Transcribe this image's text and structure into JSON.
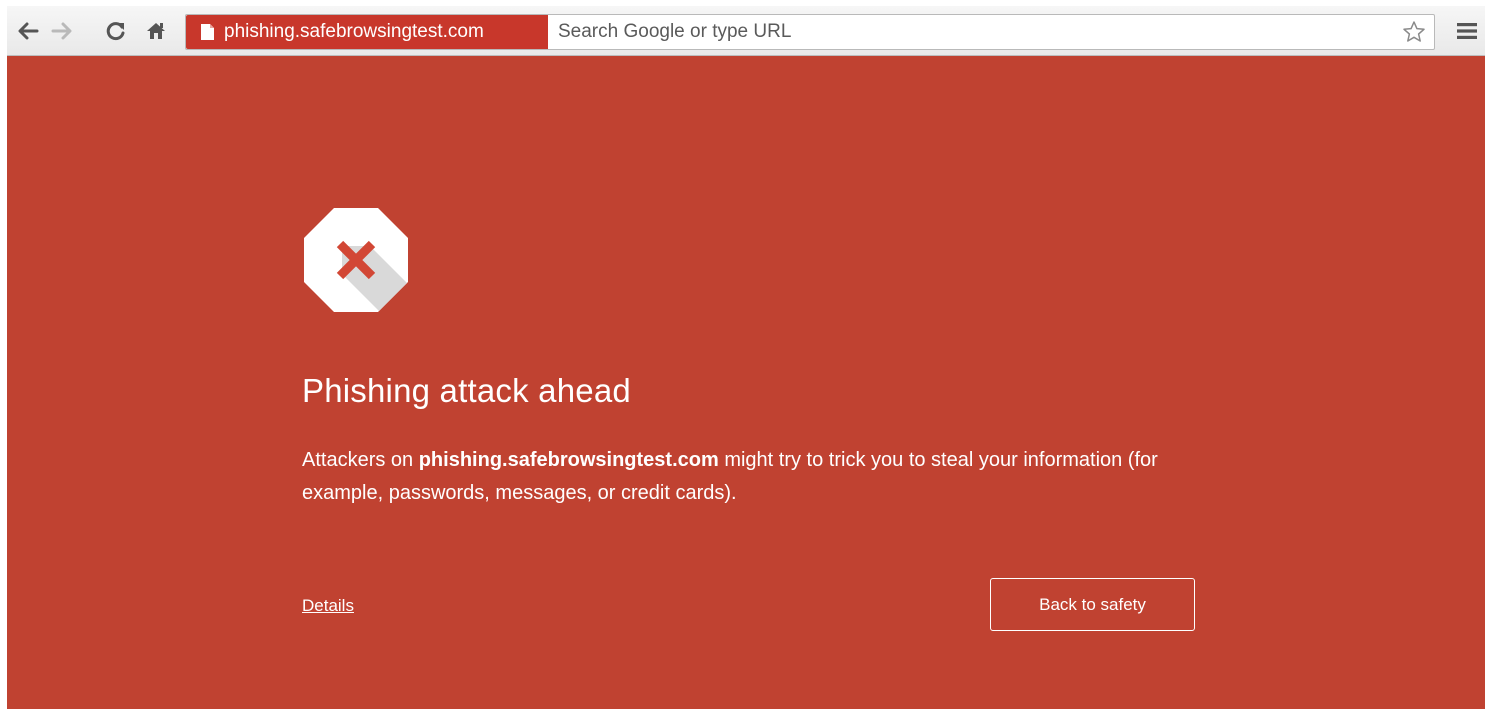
{
  "toolbar": {
    "icons": {
      "back": "back-arrow-icon",
      "forward": "forward-arrow-icon",
      "reload": "reload-icon",
      "home": "home-icon",
      "page": "page-icon",
      "star": "star-icon",
      "menu": "menu-icon"
    },
    "site_chip": "phishing.safebrowsingtest.com",
    "search_placeholder": "Search Google or type URL"
  },
  "interstitial": {
    "icon": "stop-sign-x-icon",
    "title": "Phishing attack ahead",
    "description_prefix": "Attackers on ",
    "description_domain": "phishing.safebrowsingtest.com",
    "description_suffix": " might try to trick you to steal your information (for example, passwords, messages, or credit cards).",
    "details_link": "Details",
    "back_button": "Back to safety"
  },
  "colors": {
    "page_background": "#c04231",
    "site_chip_background": "#c8372b",
    "text": "#ffffff",
    "icon_x": "#d24735"
  }
}
